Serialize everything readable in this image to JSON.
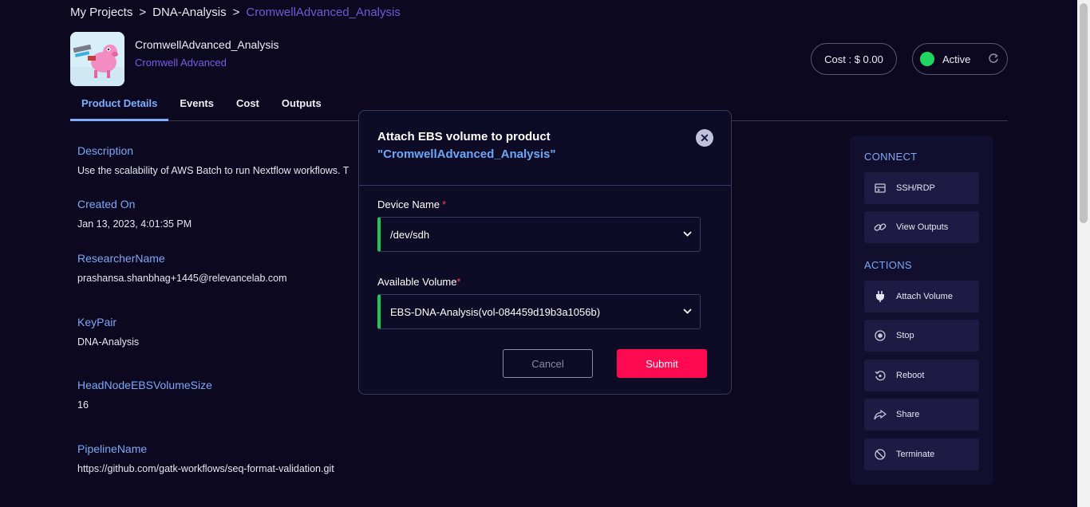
{
  "breadcrumb": {
    "items": [
      "My Projects",
      "DNA-Analysis",
      "CromwellAdvanced_Analysis"
    ],
    "separator": ">"
  },
  "product": {
    "title": "CromwellAdvanced_Analysis",
    "subtitle": "Cromwell Advanced",
    "icon": "pig-robot-logo"
  },
  "header": {
    "cost_label": "Cost : $ 0.00",
    "status_label": "Active",
    "status_color": "#1ed760",
    "refresh_icon": "refresh-icon"
  },
  "tabs": [
    "Product Details",
    "Events",
    "Cost",
    "Outputs"
  ],
  "active_tab": "Product Details",
  "details": [
    {
      "label": "Description",
      "value": "Use the scalability of AWS Batch to run Nextflow workflows. T"
    },
    {
      "label": "Created On",
      "value": "Jan 13, 2023, 4:01:35 PM"
    },
    {
      "label": "ResearcherName",
      "value": "prashansa.shanbhag+1445@relevancelab.com"
    },
    {
      "label": "KeyPair",
      "value": "DNA-Analysis"
    },
    {
      "label": "HeadNodeEBSVolumeSize",
      "value": "16"
    },
    {
      "label": "PipelineName",
      "value": "https://github.com/gatk-workflows/seq-format-validation.git"
    }
  ],
  "side_panel": {
    "connect_heading": "CONNECT",
    "connect_items": [
      {
        "label": "SSH/RDP",
        "icon": "terminal-icon"
      },
      {
        "label": "View Outputs",
        "icon": "link-icon"
      }
    ],
    "actions_heading": "ACTIONS",
    "action_items": [
      {
        "label": "Attach Volume",
        "icon": "plug-icon"
      },
      {
        "label": "Stop",
        "icon": "stop-icon"
      },
      {
        "label": "Reboot",
        "icon": "reboot-icon"
      },
      {
        "label": "Share",
        "icon": "share-icon"
      },
      {
        "label": "Terminate",
        "icon": "terminate-icon"
      }
    ]
  },
  "modal": {
    "title": "Attach EBS volume to product",
    "product_name": "\"CromwellAdvanced_Analysis\"",
    "device_label": "Device Name",
    "device_value": "/dev/sdh",
    "volume_label": "Available Volume",
    "volume_value": "EBS-DNA-Analysis(vol-084459d19b3a1056b)",
    "required_mark": "*",
    "cancel_label": "Cancel",
    "submit_label": "Submit",
    "accent_color": "#1ec75a",
    "submit_color": "#ff0a52"
  }
}
